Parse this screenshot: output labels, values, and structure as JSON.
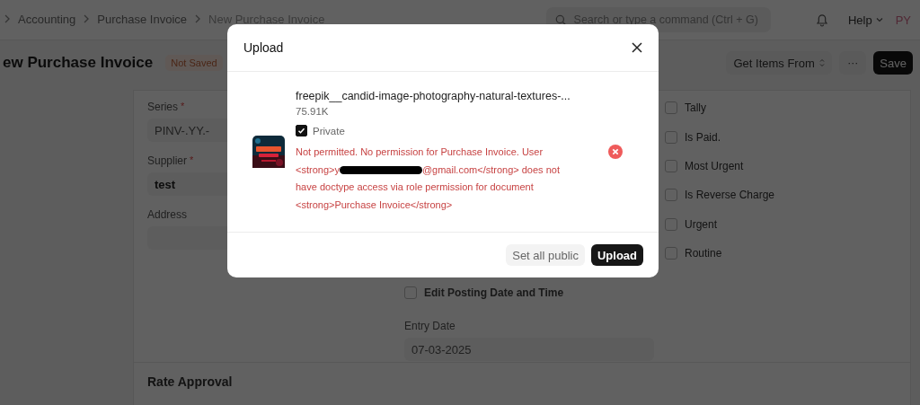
{
  "breadcrumbs": [
    "Accounting",
    "Purchase Invoice",
    "New Purchase Invoice"
  ],
  "search": {
    "placeholder": "Search or type a command (Ctrl + G)"
  },
  "help": "Help",
  "avatar": "PY",
  "page_title": "ew Purchase Invoice",
  "status_badge": "Not Saved",
  "actions": {
    "get_items": "Get Items From",
    "more": "···",
    "save": "Save"
  },
  "left_fields": [
    {
      "label": "Series",
      "required_mark": "*",
      "value": "PINV-.YY.-"
    },
    {
      "label": "Supplier",
      "required_mark": "*",
      "value": "test"
    },
    {
      "label": "Address"
    }
  ],
  "posting_checkbox": {
    "label": "Edit Posting Date and Time",
    "checked": false
  },
  "entry_date": {
    "label": "Entry Date",
    "value": "07-03-2025"
  },
  "checkboxes": [
    {
      "label": "Tally",
      "checked": false
    },
    {
      "label": "Is Paid.",
      "checked": false
    },
    {
      "label": "Most Urgent",
      "checked": false
    },
    {
      "label": "Is Reverse Charge",
      "checked": false
    },
    {
      "label": "Urgent",
      "checked": false
    },
    {
      "label": "Routine",
      "checked": false
    }
  ],
  "section": "Rate Approval",
  "dialog": {
    "title": "Upload",
    "file": {
      "name": "freepik__candid-image-photography-natural-textures-...",
      "size": "75.91K",
      "private_label": "Private",
      "private": true,
      "error_lines_before": [
        "Not permitted. No permission for Purchase Invoice. User"
      ],
      "error_redacted_line": {
        "before": "<strong>y",
        "redacted": true,
        "after": "@gmail.com</strong> does not"
      },
      "error_lines_after": [
        "have doctype access via role permission for document",
        "<strong>Purchase Invoice</strong>"
      ]
    },
    "buttons": [
      {
        "label": "Set all public",
        "kind": "secondary"
      },
      {
        "label": "Upload",
        "kind": "primary"
      }
    ]
  }
}
